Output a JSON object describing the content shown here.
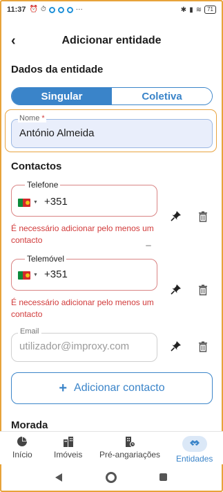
{
  "status_bar": {
    "time": "11:37",
    "battery": "71"
  },
  "header": {
    "back_icon": "chevron-left-icon",
    "title": "Adicionar entidade"
  },
  "entity_section": {
    "title": "Dados da entidade",
    "segments": [
      "Singular",
      "Coletiva"
    ],
    "active_segment": 0
  },
  "name_field": {
    "label": "Nome",
    "required_mark": "*",
    "value": "António Almeida"
  },
  "contacts": {
    "title": "Contactos",
    "phone": {
      "label": "Telefone",
      "prefix": "+351",
      "error": "É necessário adicionar pelo menos um contacto"
    },
    "mobile": {
      "label": "Telemóvel",
      "prefix": "+351",
      "error": "É necessário adicionar pelo menos um contacto"
    },
    "email": {
      "label": "Email",
      "placeholder": "utilizador@improxy.com"
    },
    "add_button": "Adicionar contacto"
  },
  "address_section": {
    "title": "Morada"
  },
  "bottom_nav": {
    "items": [
      {
        "label": "Início",
        "icon": "pie-chart-icon"
      },
      {
        "label": "Imóveis",
        "icon": "buildings-icon"
      },
      {
        "label": "Pré-angariações",
        "icon": "building-clock-icon"
      },
      {
        "label": "Entidades",
        "icon": "handshake-icon"
      }
    ],
    "active": 3
  },
  "colors": {
    "accent": "#3a84c9",
    "error": "#d13a3a",
    "highlight": "#e8a33f"
  }
}
